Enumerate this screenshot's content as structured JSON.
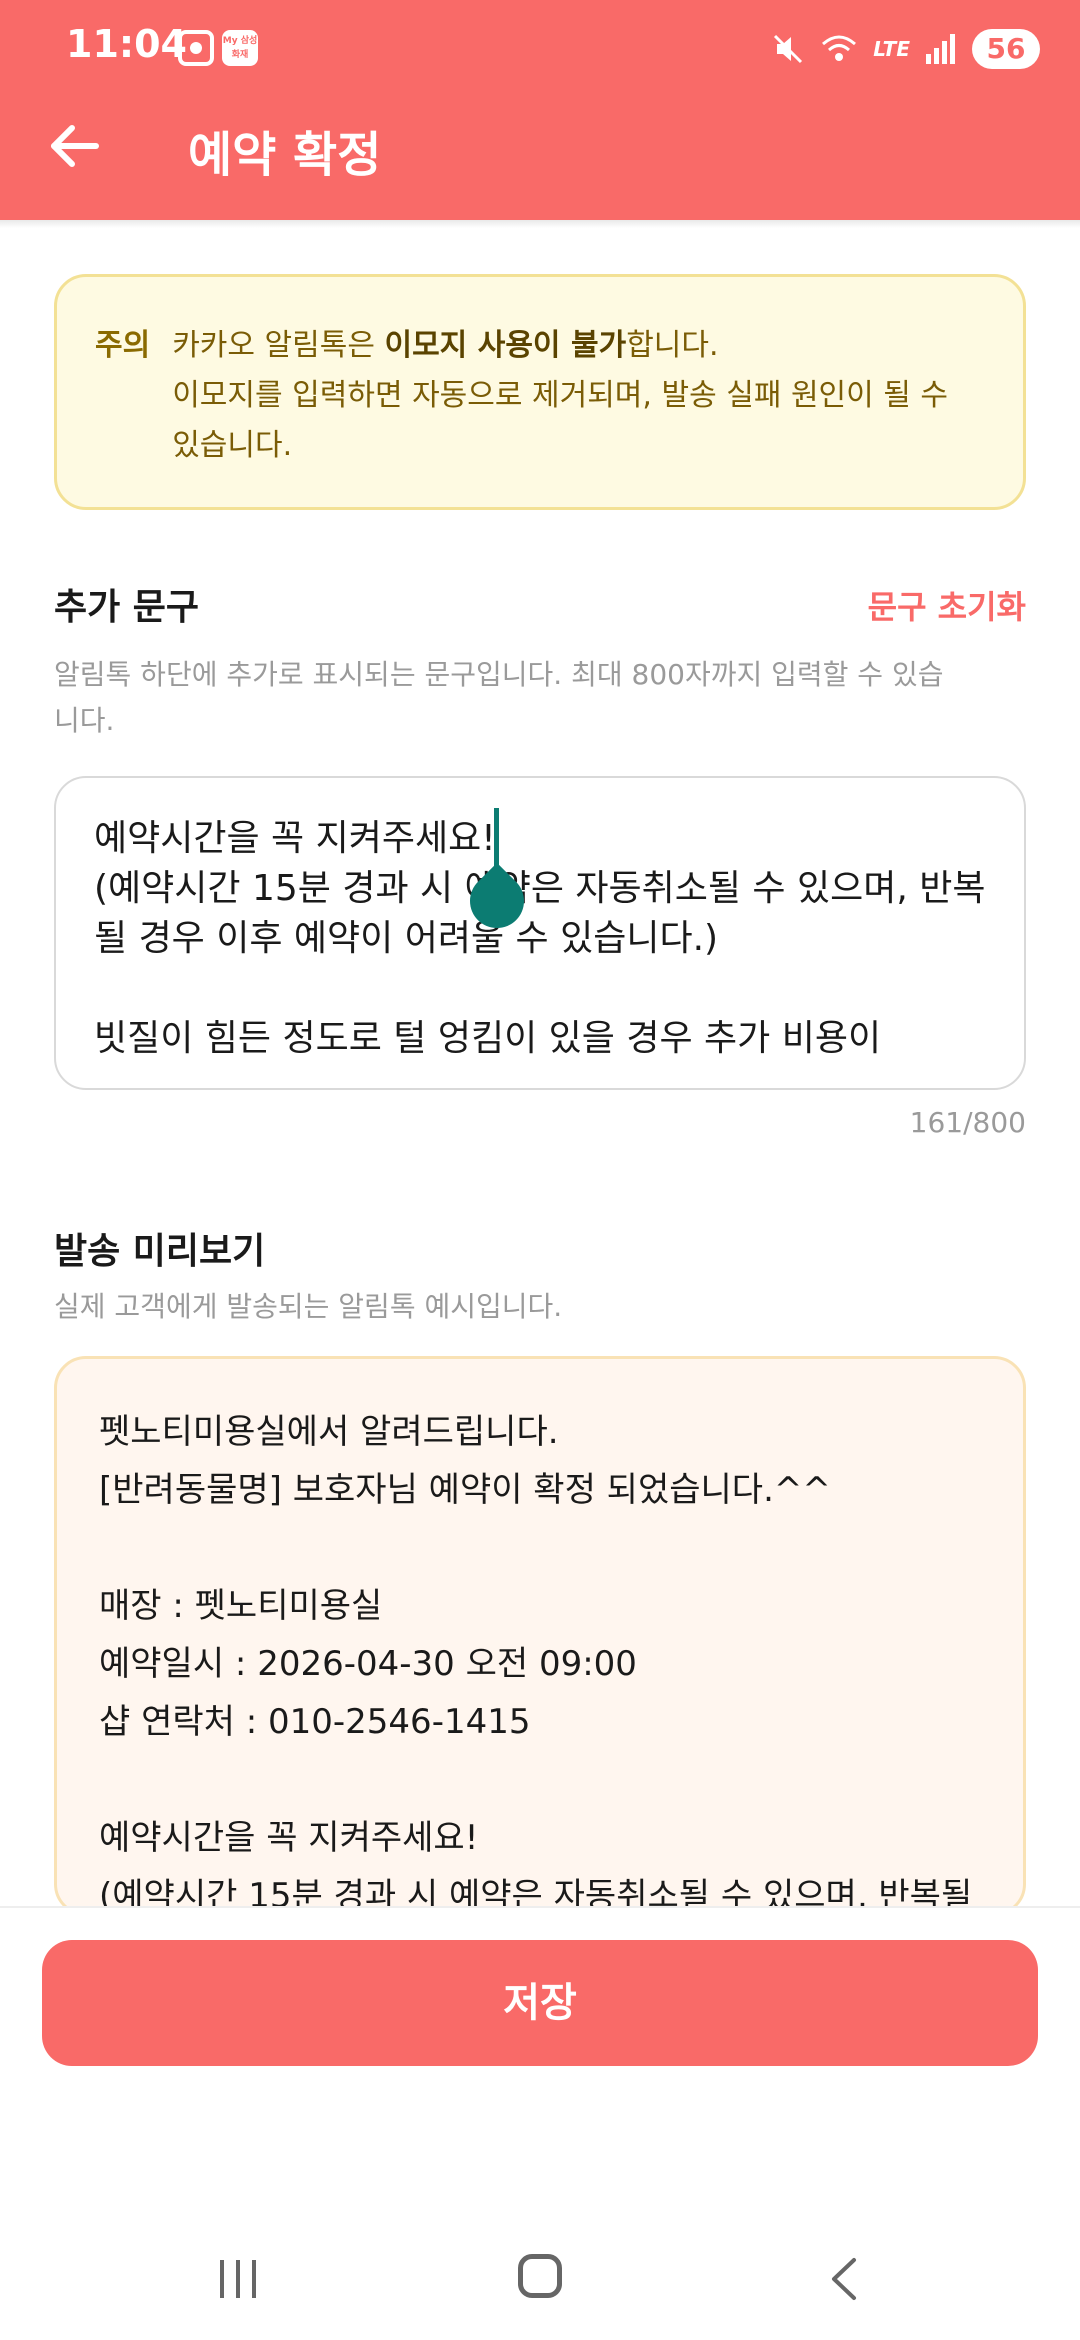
{
  "status_bar": {
    "time": "11:04",
    "app_icon_text": "My\n삼성화재",
    "battery": "56",
    "network": "LTE"
  },
  "header": {
    "title": "예약 확정"
  },
  "notice": {
    "label": "주의",
    "line1_prefix": "카카오 알림톡은 ",
    "line1_bold": "이모지 사용이 불가",
    "line1_suffix": "합니다.",
    "line2": "이모지를 입력하면 자동으로 제거되며, 발송 실패 원인이 될 수 있습니다."
  },
  "extra_text": {
    "title": "추가 문구",
    "reset_label": "문구 초기화",
    "description": "알림톡 하단에 추가로 표시되는 문구입니다. 최대 800자까지 입력할 수 있습니다.",
    "value": "예약시간을 꼭 지켜주세요!\n(예약시간 15분 경과 시 예약은 자동취소될 수 있으며, 반복될 경우 이후 예약이 어려울 수 있습니다.)\n\n빗질이 힘든 정도로 털 엉킴이 있을 경우 추가 비용이",
    "counter": "161/800"
  },
  "preview": {
    "title": "발송 미리보기",
    "description": "실제 고객에게 발송되는 알림톡 예시입니다.",
    "lines": [
      "펫노티미용실에서 알려드립니다.",
      "[반려동물명] 보호자님 예약이 확정 되었습니다.^^",
      "",
      "매장 : 펫노티미용실",
      "예약일시 : 2026-04-30 오전 09:00",
      "샵 연락처 : 010-2546-1415",
      "",
      "예약시간을 꼭 지켜주세요!",
      "(예약시간 15분 경과 시 예약은 자동취소될 수 있으며, 반복될"
    ]
  },
  "save_button": {
    "label": "저장"
  },
  "icons": {
    "back": "arrow-left-icon",
    "mute": "mute-icon",
    "wifi": "wifi-icon",
    "signal": "signal-icon"
  },
  "colors": {
    "accent": "#f96a68",
    "notice_bg": "#fefae2",
    "preview_bg": "#fff6ef",
    "cursor": "#0c7c72"
  }
}
